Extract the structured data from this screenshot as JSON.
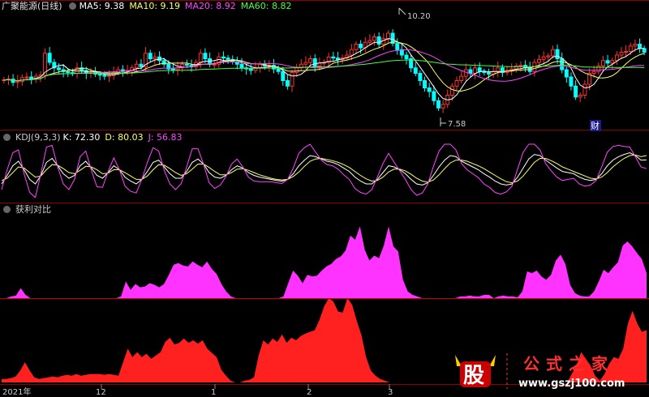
{
  "header": {
    "title": "广聚能源(日线)",
    "ma": [
      {
        "label": "MA5: 9.38",
        "color": "#ffffff"
      },
      {
        "label": "MA10: 9.19",
        "color": "#ffff66"
      },
      {
        "label": "MA20: 8.92",
        "color": "#ff44ff"
      },
      {
        "label": "MA60: 8.82",
        "color": "#44ff44"
      }
    ]
  },
  "kdj_header": {
    "name": "KDJ(9,3,3)",
    "k": "K: 72.30",
    "d": "D: 80.03",
    "j": "J: 56.83"
  },
  "profit_header": {
    "name": "获利对比"
  },
  "annotations": {
    "high": "10.20",
    "low": "7.58",
    "tag": "财"
  },
  "xaxis": {
    "labels": [
      "2021年",
      "12",
      "1",
      "2",
      "3"
    ]
  },
  "watermark": {
    "logo": "股",
    "name": "公式之家",
    "url": "www.gszj100.com"
  },
  "colors": {
    "up": "#ff3030",
    "down": "#00ffff",
    "k": "#ffffff",
    "d": "#ffff66",
    "j": "#ff44ff",
    "profit_top": "#ff33ff",
    "profit_bottom": "#ff2020",
    "grid": "#8b0000"
  },
  "chart_data": [
    {
      "type": "candlestick",
      "title": "广聚能源(日线)",
      "ylim": [
        7.3,
        10.5
      ],
      "close": [
        8.62,
        8.64,
        8.55,
        8.58,
        8.68,
        8.7,
        8.64,
        8.72,
        8.75,
        9.35,
        9.1,
        8.95,
        8.9,
        8.85,
        8.82,
        8.8,
        8.95,
        8.88,
        8.8,
        8.82,
        8.78,
        8.75,
        8.72,
        8.74,
        8.82,
        8.9,
        8.85,
        8.88,
        8.95,
        9.05,
        8.98,
        9.35,
        9.2,
        9.25,
        9.15,
        9.05,
        8.92,
        8.9,
        8.95,
        9.05,
        9.02,
        8.98,
        9.1,
        9.35,
        9.2,
        9.05,
        9.05,
        9.25,
        9.22,
        9.18,
        9.12,
        9.05,
        8.95,
        8.92,
        8.88,
        8.96,
        9.05,
        9.0,
        9.02,
        8.92,
        8.85,
        8.6,
        8.45,
        8.82,
        8.95,
        9.05,
        9.1,
        9.2,
        9.0,
        9.08,
        9.1,
        9.25,
        9.22,
        9.18,
        9.22,
        9.3,
        9.45,
        9.6,
        9.5,
        9.65,
        9.7,
        9.8,
        9.6,
        9.75,
        9.9,
        9.62,
        9.45,
        9.3,
        9.2,
        8.95,
        8.8,
        8.6,
        8.4,
        8.3,
        8.05,
        7.85,
        7.95,
        8.2,
        8.45,
        8.6,
        8.72,
        8.9,
        8.8,
        8.95,
        8.85,
        8.82,
        8.78,
        8.85,
        8.95,
        8.82,
        8.88,
        8.92,
        9.0,
        9.02,
        8.95,
        8.85,
        9.1,
        9.18,
        9.25,
        9.28,
        9.45,
        9.2,
        8.9,
        8.7,
        8.45,
        8.15,
        8.2,
        8.5,
        8.8,
        8.85,
        9.0,
        9.15,
        9.08,
        9.15,
        9.3,
        9.38,
        9.4,
        9.55,
        9.6,
        9.48,
        9.38
      ],
      "high_label": "10.20",
      "low_label": "7.58",
      "ma_lines": {
        "MA5": 9.38,
        "MA10": 9.19,
        "MA20": 8.92,
        "MA60": 8.82
      }
    },
    {
      "type": "line",
      "title": "KDJ(9,3,3)",
      "ylim": [
        0,
        100
      ],
      "series": [
        {
          "name": "K",
          "values": [
            30,
            45,
            62,
            70,
            55,
            38,
            30,
            45,
            68,
            75,
            62,
            48,
            40,
            45,
            62,
            70,
            58,
            45,
            40,
            50,
            62,
            55,
            42,
            35,
            30,
            38,
            52,
            68,
            72,
            60,
            48,
            40,
            40,
            52,
            68,
            74,
            65,
            50,
            42,
            40,
            45,
            55,
            62,
            58,
            50,
            45,
            42,
            40,
            38,
            36,
            35,
            38,
            48,
            62,
            72,
            80,
            78,
            74,
            70,
            68,
            64,
            58,
            52,
            42,
            35,
            30,
            30,
            38,
            50,
            62,
            60,
            55,
            48,
            38,
            30,
            28,
            32,
            45,
            60,
            72,
            80,
            78,
            70,
            65,
            60,
            55,
            48,
            42,
            35,
            30,
            28,
            30,
            42,
            58,
            74,
            82,
            80,
            72,
            65,
            58,
            52,
            50,
            48,
            42,
            38,
            36,
            38,
            48,
            62,
            72,
            78,
            82,
            85,
            80,
            72,
            72.3
          ]
        },
        {
          "name": "D",
          "values": [
            36,
            40,
            50,
            60,
            58,
            50,
            42,
            44,
            55,
            64,
            63,
            57,
            50,
            48,
            54,
            61,
            60,
            55,
            48,
            49,
            55,
            55,
            50,
            44,
            38,
            38,
            44,
            55,
            64,
            63,
            57,
            50,
            45,
            48,
            56,
            65,
            65,
            59,
            52,
            46,
            46,
            50,
            56,
            57,
            54,
            50,
            46,
            43,
            40,
            38,
            37,
            38,
            43,
            51,
            61,
            70,
            74,
            75,
            73,
            71,
            68,
            64,
            59,
            52,
            45,
            39,
            35,
            36,
            42,
            51,
            56,
            56,
            53,
            47,
            40,
            35,
            33,
            37,
            46,
            57,
            67,
            72,
            72,
            70,
            66,
            62,
            57,
            51,
            45,
            39,
            34,
            32,
            35,
            44,
            56,
            68,
            75,
            75,
            71,
            66,
            60,
            56,
            52,
            48,
            44,
            40,
            39,
            42,
            50,
            60,
            68,
            75,
            80,
            81,
            78,
            80.03
          ]
        },
        {
          "name": "J",
          "values": [
            20,
            55,
            85,
            90,
            48,
            15,
            6,
            48,
            95,
            98,
            60,
            30,
            20,
            38,
            78,
            88,
            54,
            25,
            24,
            52,
            76,
            55,
            26,
            17,
            14,
            38,
            68,
            94,
            88,
            54,
            30,
            20,
            30,
            60,
            92,
            92,
            65,
            32,
            22,
            28,
            43,
            65,
            74,
            60,
            42,
            35,
            34,
            34,
            34,
            32,
            31,
            38,
            58,
            84,
            94,
            100,
            86,
            72,
            64,
            62,
            56,
            46,
            38,
            22,
            15,
            12,
            20,
            42,
            66,
            84,
            68,
            53,
            38,
            20,
            10,
            14,
            30,
            61,
            88,
            100,
            100,
            90,
            66,
            55,
            48,
            41,
            30,
            24,
            15,
            12,
            16,
            26,
            56,
            86,
            100,
            100,
            90,
            66,
            53,
            42,
            36,
            38,
            40,
            30,
            26,
            28,
            36,
            60,
            86,
            96,
            98,
            96,
            95,
            78,
            60,
            56.83
          ]
        }
      ]
    },
    {
      "type": "area",
      "title": "获利对比",
      "ylim": [
        0,
        100
      ],
      "series": [
        {
          "name": "upper",
          "values": [
            0,
            0,
            2,
            3,
            12,
            4,
            0,
            0,
            0,
            0,
            0,
            0,
            0,
            0,
            0,
            0,
            0,
            0,
            0,
            0,
            0,
            0,
            0,
            0,
            0,
            2,
            20,
            10,
            17,
            13,
            14,
            18,
            16,
            13,
            17,
            28,
            40,
            42,
            39,
            38,
            44,
            40,
            37,
            44,
            35,
            29,
            17,
            8,
            2,
            0,
            0,
            0,
            0,
            0,
            0,
            0,
            0,
            0,
            0,
            2,
            18,
            33,
            27,
            18,
            28,
            26,
            27,
            33,
            38,
            41,
            47,
            50,
            57,
            75,
            70,
            86,
            58,
            45,
            51,
            48,
            63,
            86,
            62,
            56,
            22,
            8,
            4,
            2,
            0,
            0,
            0,
            0,
            0,
            0,
            0,
            0,
            2,
            2,
            3,
            2,
            2,
            4,
            4,
            0,
            2,
            3,
            2,
            2,
            1,
            8,
            32,
            30,
            33,
            26,
            22,
            28,
            45,
            52,
            41,
            16,
            6,
            3,
            2,
            2,
            8,
            20,
            34,
            30,
            37,
            43,
            63,
            68,
            62,
            54,
            47,
            30
          ]
        },
        {
          "name": "lower",
          "values": [
            4,
            4,
            5,
            7,
            14,
            24,
            14,
            6,
            4,
            5,
            6,
            7,
            6,
            8,
            9,
            8,
            10,
            8,
            9,
            10,
            10,
            10,
            9,
            10,
            9,
            8,
            24,
            40,
            30,
            36,
            30,
            34,
            28,
            32,
            36,
            48,
            53,
            45,
            47,
            52,
            47,
            50,
            46,
            50,
            40,
            35,
            30,
            15,
            8,
            2,
            0,
            0,
            2,
            3,
            6,
            32,
            50,
            45,
            52,
            48,
            57,
            47,
            53,
            50,
            55,
            58,
            60,
            62,
            74,
            90,
            100,
            96,
            84,
            83,
            100,
            92,
            73,
            56,
            30,
            14,
            8,
            4,
            2,
            0,
            0,
            0,
            0,
            0,
            0,
            0,
            0,
            0,
            0,
            0,
            0,
            0,
            0,
            0,
            0,
            0,
            0,
            0,
            0,
            0,
            0,
            0,
            0,
            0,
            0,
            0,
            0,
            0,
            0,
            0,
            0,
            0,
            0,
            0,
            0,
            0,
            0,
            0,
            10,
            20,
            36,
            28,
            20,
            8,
            2,
            10,
            22,
            30,
            28,
            40,
            70,
            85,
            70,
            60,
            62
          ]
        }
      ]
    }
  ]
}
